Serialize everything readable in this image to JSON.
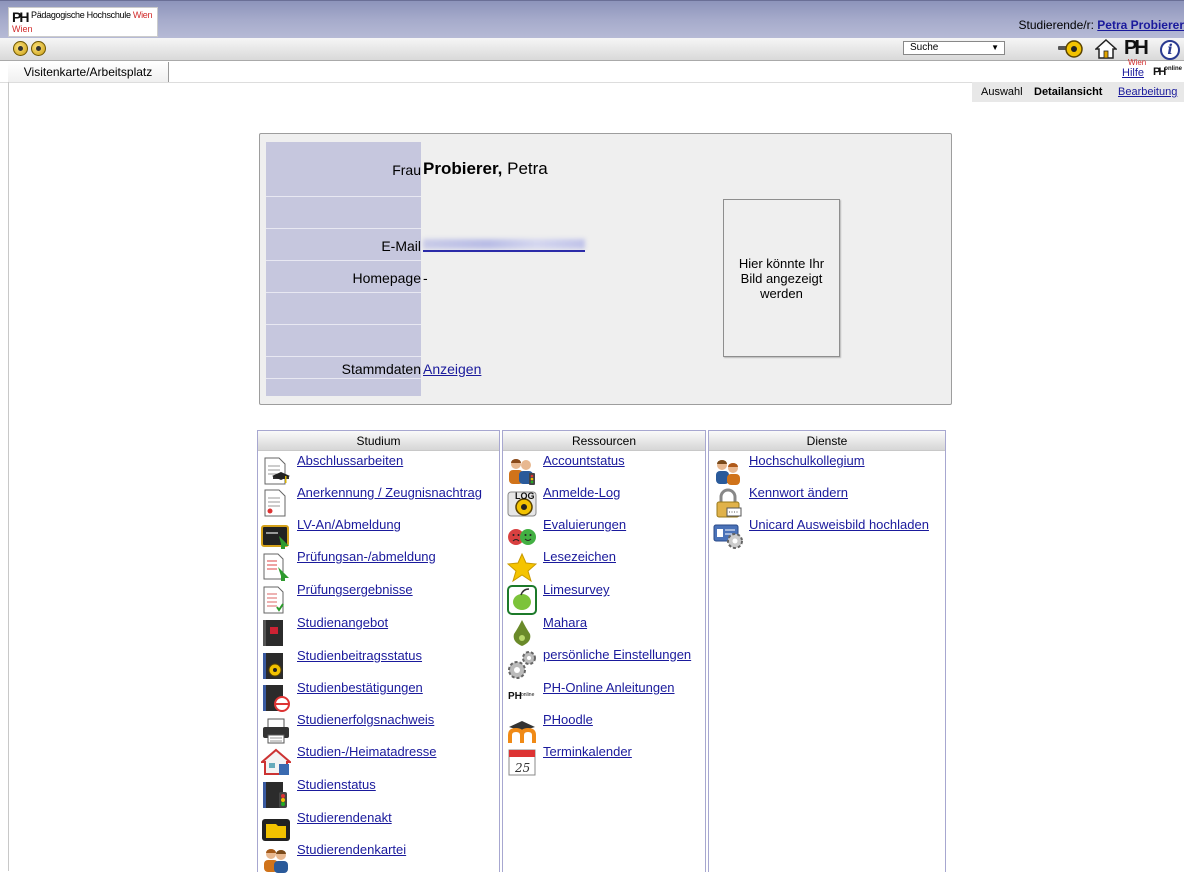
{
  "header": {
    "logo_ph": "PH",
    "logo_name": "Pädagogische Hochschule",
    "logo_city": "Wien",
    "user_prefix": "Studierende/r:",
    "user_name": "Petra Probierer"
  },
  "toolbar": {
    "search_select": "Suche"
  },
  "tabs": {
    "active": "Visitenkarte/Arbeitsplatz",
    "help": "Hilfe"
  },
  "viewmodes": {
    "auswahl": "Auswahl",
    "detail": "Detailansicht",
    "bearbeitung": "Bearbeitung"
  },
  "card": {
    "salutation": "Frau",
    "lastname": "Probierer,",
    "firstname": "Petra",
    "email_label": "E-Mail",
    "homepage_label": "Homepage",
    "homepage_value": "-",
    "stammdaten_label": "Stammdaten",
    "stammdaten_link": "Anzeigen",
    "photo_placeholder": "Hier könnte Ihr Bild angezeigt werden"
  },
  "panels": {
    "studium": {
      "title": "Studium",
      "items": [
        {
          "label": "Abschlussarbeiten",
          "icon": "thesis-icon"
        },
        {
          "label": "Anerkennung / Zeugnisnachtrag",
          "icon": "certificate-icon"
        },
        {
          "label": "LV-An/Abmeldung",
          "icon": "course-registration-icon"
        },
        {
          "label": "Prüfungsan-/abmeldung",
          "icon": "exam-registration-icon"
        },
        {
          "label": "Prüfungsergebnisse",
          "icon": "exam-results-icon"
        },
        {
          "label": "Studienangebot",
          "icon": "study-offer-book-icon"
        },
        {
          "label": "Studienbeitragsstatus",
          "icon": "fee-status-icon"
        },
        {
          "label": "Studienbestätigungen",
          "icon": "confirmation-stamp-icon"
        },
        {
          "label": "Studienerfolgsnachweis",
          "icon": "printer-icon"
        },
        {
          "label": "Studien-/Heimatadresse",
          "icon": "home-address-icon"
        },
        {
          "label": "Studienstatus",
          "icon": "traffic-light-book-icon"
        },
        {
          "label": "Studierendenakt",
          "icon": "folder-icon"
        },
        {
          "label": "Studierendenkartei",
          "icon": "students-icon"
        }
      ]
    },
    "ressourcen": {
      "title": "Ressourcen",
      "items": [
        {
          "label": "Accountstatus",
          "icon": "account-status-icon"
        },
        {
          "label": "Anmelde-Log",
          "icon": "login-log-icon"
        },
        {
          "label": "Evaluierungen",
          "icon": "evaluation-faces-icon"
        },
        {
          "label": "Lesezeichen",
          "icon": "star-icon"
        },
        {
          "label": "Limesurvey",
          "icon": "limesurvey-icon"
        },
        {
          "label": "Mahara",
          "icon": "mahara-icon"
        },
        {
          "label": "persönliche Einstellungen",
          "icon": "settings-gears-icon"
        },
        {
          "label": "PH-Online Anleitungen",
          "icon": "ph-online-icon"
        },
        {
          "label": "PHoodle",
          "icon": "moodle-icon"
        },
        {
          "label": "Terminkalender",
          "icon": "calendar-icon"
        }
      ]
    },
    "dienste": {
      "title": "Dienste",
      "items": [
        {
          "label": "Hochschulkollegium",
          "icon": "people-group-icon"
        },
        {
          "label": "Kennwort ändern",
          "icon": "padlock-icon"
        },
        {
          "label": "Unicard Ausweisbild hochladen",
          "icon": "id-card-upload-icon"
        }
      ]
    }
  },
  "calendar_day": "25",
  "ph_online_text": "online",
  "log_text": "LOG",
  "info_glyph": "i"
}
